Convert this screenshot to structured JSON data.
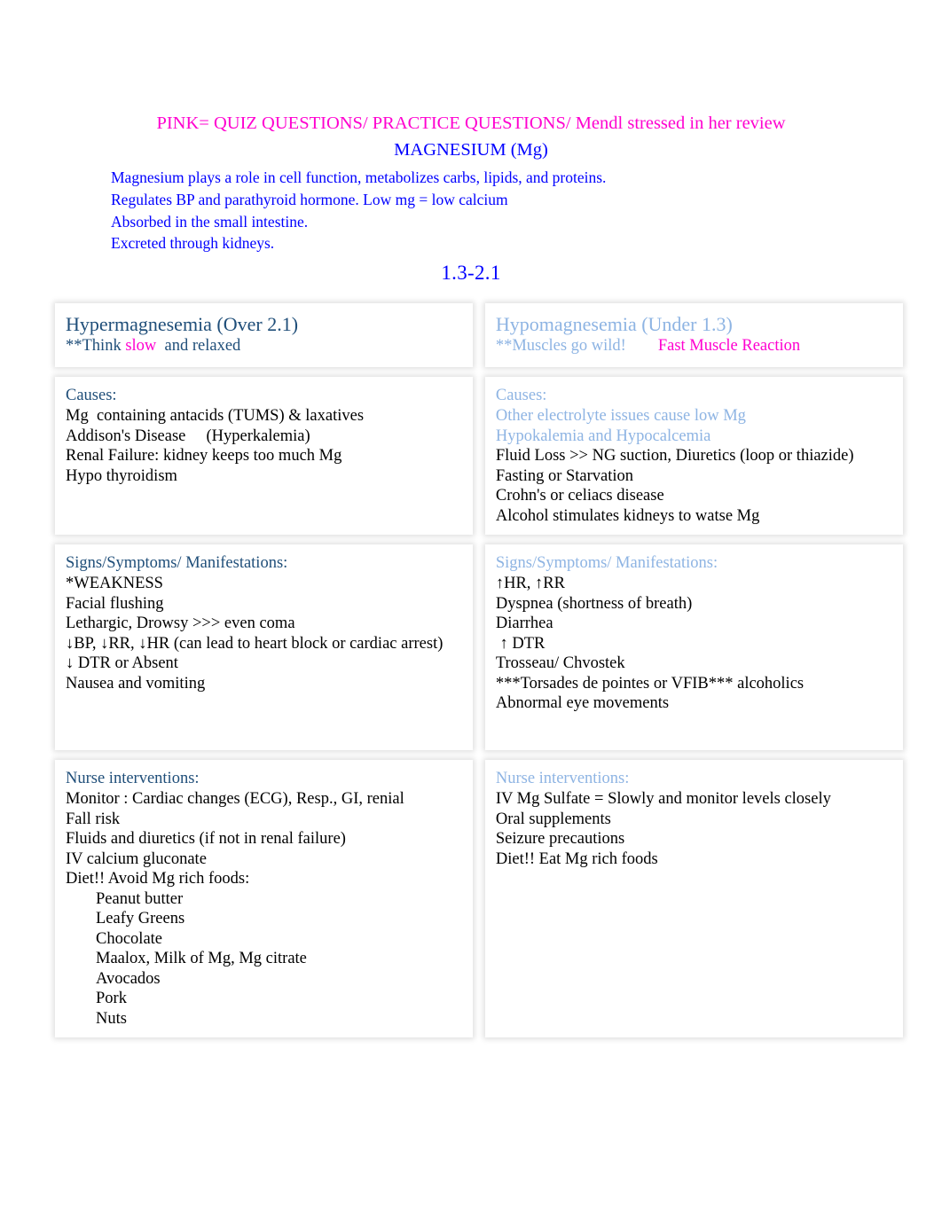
{
  "header": {
    "pink_banner": "PINK= QUIZ QUESTIONS/ PRACTICE QUESTIONS/ Mendl stressed in her review",
    "title": "MAGNESIUM (Mg)",
    "intro_lines": [
      "Magnesium plays a role in cell function, metabolizes carbs, lipids, and proteins.",
      "Regulates BP and parathyroid hormone. Low mg = low calcium",
      "Absorbed in the small intestine.",
      "Excreted through kidneys."
    ],
    "normal_range": "1.3-2.1"
  },
  "colors": {
    "pink": "#FF00D0",
    "blue": "#0000FF",
    "navy": "#1F4E79",
    "light_blue": "#8EB4E3",
    "black": "#000000"
  },
  "table": {
    "left": {
      "title": "Hypermagnesemia (Over 2.1)",
      "subtitle_pre": "**Think ",
      "subtitle_pink": "slow",
      "subtitle_post": "  and relaxed",
      "causes_head": "Causes:",
      "causes": [
        "Mg  containing antacids (TUMS) & laxatives",
        "Addison's Disease     (Hyperkalemia)",
        "Renal Failure: kidney keeps too much Mg",
        "Hypo thyroidism"
      ],
      "signs_head": "Signs/Symptoms/ Manifestations:",
      "signs": [
        "*WEAKNESS",
        "Facial flushing",
        "Lethargic, Drowsy >>> even coma",
        "↓BP, ↓RR, ↓HR (can lead to heart block or cardiac arrest)",
        "↓ DTR or Absent",
        "Nausea and vomiting"
      ],
      "nurse_head": "Nurse interventions:",
      "nurse": [
        "Monitor : Cardiac changes (ECG), Resp., GI, renial",
        "Fall risk",
        "Fluids and diuretics (if not in renal failure)",
        "IV calcium gluconate",
        "Diet!! Avoid Mg rich foods:"
      ],
      "nurse_sub": [
        "Peanut butter",
        "Leafy Greens",
        "Chocolate",
        "Maalox, Milk of Mg, Mg citrate",
        "Avocados",
        "Pork",
        "Nuts"
      ]
    },
    "right": {
      "title": "Hypomagnesemia (Under 1.3)",
      "subtitle_pre": "**Muscles go wild!",
      "subtitle_pink": "Fast Muscle Reaction",
      "causes_head": "Causes:",
      "causes_blue": [
        "Other electrolyte issues cause low Mg",
        "Hypokalemia and Hypocalcemia"
      ],
      "causes_black": [
        "Fluid Loss >> NG suction, Diuretics (loop or thiazide)",
        "Fasting or Starvation",
        "Crohn's or celiacs disease",
        "Alcohol stimulates kidneys to watse Mg"
      ],
      "signs_head": "Signs/Symptoms/ Manifestations:",
      "signs": [
        "↑HR, ↑RR",
        "Dyspnea (shortness of breath)",
        "Diarrhea",
        " ↑ DTR",
        "Trosseau/ Chvostek",
        "***Torsades de pointes or VFIB*** alcoholics",
        "Abnormal eye movements"
      ],
      "nurse_head": "Nurse interventions:",
      "nurse": [
        "IV Mg Sulfate = Slowly and monitor levels closely",
        "Oral supplements",
        "Seizure precautions",
        "Diet!! Eat Mg rich foods"
      ]
    }
  }
}
